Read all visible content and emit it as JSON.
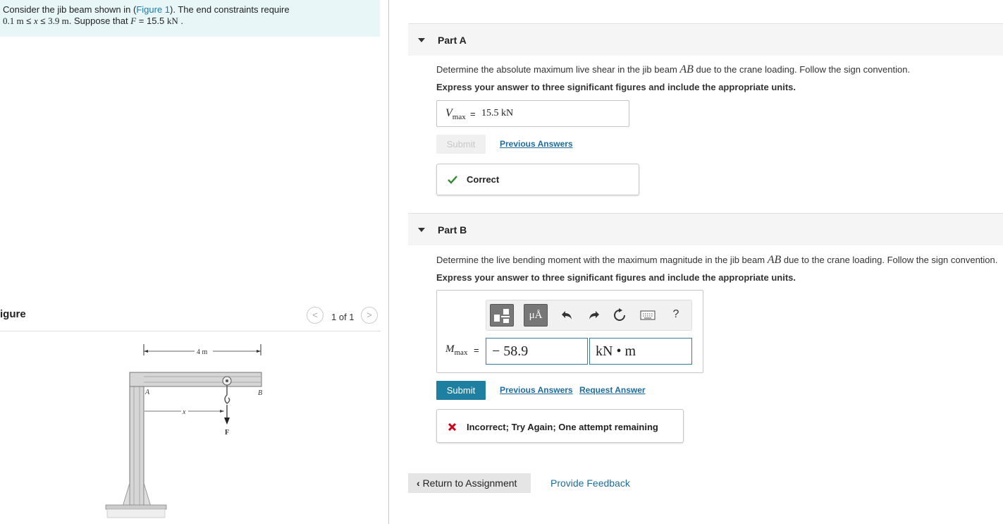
{
  "problem": {
    "line1_prefix": "Consider the jib beam shown in (",
    "figure_link": "Figure 1",
    "line1_suffix": "). The end constraints require",
    "line2_a": "0.1 m",
    "line2_leq1": " ≤ ",
    "line2_var": "x",
    "line2_leq2": " ≤ ",
    "line2_b": "3.9 m",
    "line2_mid": ". Suppose that ",
    "line2_F": "F",
    "line2_eq": " = 15.5 ",
    "line2_unit": "kN",
    "line2_end": " ."
  },
  "figure": {
    "title": "igure",
    "pager_prev": "<",
    "pager_next": ">",
    "pager_count": "1 of 1",
    "dim_label": "4 m",
    "label_A": "A",
    "label_B": "B",
    "label_x": "x",
    "label_F": "F"
  },
  "part_a": {
    "title": "Part A",
    "question_pre": "Determine the absolute maximum live shear in the jib beam ",
    "question_var": "AB",
    "question_post": " due to the crane loading. Follow the sign convention.",
    "instruction": "Express your answer to three significant figures and include the appropriate units.",
    "answer_label_main": "V",
    "answer_label_sub": "max",
    "answer_eq": "=",
    "answer_value": "15.5 kN",
    "submit_label": "Submit",
    "previous_answers": "Previous Answers",
    "feedback": "Correct"
  },
  "part_b": {
    "title": "Part B",
    "question_pre": "Determine the live bending moment with the maximum magnitude in the jib beam ",
    "question_var": "AB",
    "question_post": " due to the crane loading. Follow the sign convention.",
    "instruction": "Express your answer to three significant figures and include the appropriate units.",
    "toolbar": {
      "units_label": "μÅ",
      "help_label": "?"
    },
    "answer_label_main": "M",
    "answer_label_sub": "max",
    "answer_eq": "=",
    "value_input": "− 58.9",
    "unit_input": "kN • m",
    "submit_label": "Submit",
    "previous_answers": "Previous Answers",
    "request_answer": "Request Answer",
    "feedback": "Incorrect; Try Again; One attempt remaining"
  },
  "footer": {
    "return_label": "Return to Assignment",
    "provide_feedback": "Provide Feedback"
  },
  "colors": {
    "accent": "#1e7fa1",
    "link": "#1f6c9c",
    "correct": "#2e8b2e",
    "incorrect": "#d0021b",
    "problem_bg": "#e8f6f8"
  }
}
